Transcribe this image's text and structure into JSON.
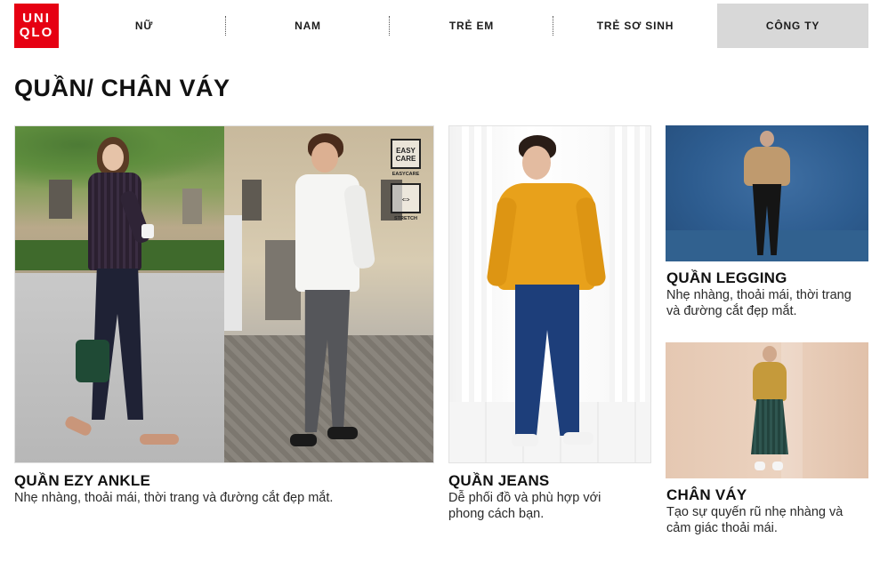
{
  "brand": {
    "logo_line1": "UNI",
    "logo_line2": "QLO",
    "color": "#e60012"
  },
  "nav": {
    "items": [
      {
        "label": "NỮ"
      },
      {
        "label": "NAM"
      },
      {
        "label": "TRẺ EM"
      },
      {
        "label": "TRẺ SƠ SINH"
      },
      {
        "label": "CÔNG TY"
      }
    ],
    "active_index": 4
  },
  "page": {
    "title": "QUẦN/ CHÂN VÁY"
  },
  "cards": [
    {
      "title": "QUẦN EZY ANKLE",
      "desc": "Nhẹ nhàng, thoải mái, thời trang và đường cắt đẹp mắt."
    },
    {
      "title": "QUẦN JEANS",
      "desc_line1": "Dễ phối đồ và phù hợp với",
      "desc_line2": "phong cách bạn."
    },
    {
      "title": "QUẦN LEGGING",
      "desc_line1": "Nhẹ nhàng, thoải mái, thời trang",
      "desc_line2": "và đường cắt đẹp mắt."
    },
    {
      "title": "CHÂN VÁY",
      "desc_line1": "Tạo sự quyến rũ nhẹ nhàng và",
      "desc_line2": "cảm giác thoải mái."
    }
  ],
  "badges": {
    "easy_care_line1": "EASY",
    "easy_care_line2": "CARE",
    "easy_care_caption": "EASYCARE",
    "stretch_caption": "STRETCH"
  }
}
